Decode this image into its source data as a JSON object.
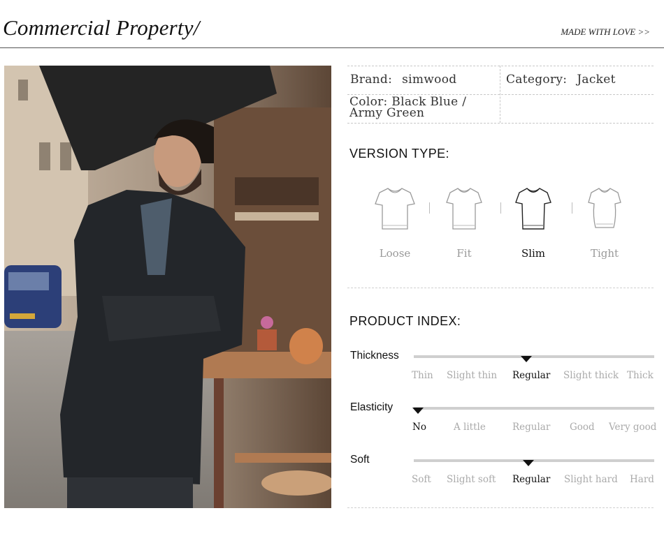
{
  "header": {
    "title": "Commercial Property/",
    "tagline": "MADE WITH LOVE >>"
  },
  "photo": {
    "alt_subject": "model-wearing-black-jacket"
  },
  "specs": {
    "brand_key": "Brand:",
    "brand_value": "simwood",
    "category_key": "Category:",
    "category_value": "Jacket",
    "color_key": "Color:",
    "color_value": "Black Blue / Army Green"
  },
  "version_type": {
    "title": "VERSION TYPE:",
    "items": [
      {
        "label": "Loose",
        "active": false
      },
      {
        "label": "Fit",
        "active": false
      },
      {
        "label": "Slim",
        "active": true
      },
      {
        "label": "Tight",
        "active": false
      }
    ]
  },
  "product_index": {
    "title": "PRODUCT INDEX:",
    "rows": [
      {
        "label": "Thickness",
        "options": [
          "Thin",
          "Slight thin",
          "Regular",
          "Slight thick",
          "Thick"
        ],
        "selected": 2
      },
      {
        "label": "Elasticity",
        "options": [
          "No",
          "A little",
          "Regular",
          "Good",
          "Very good"
        ],
        "selected": 0
      },
      {
        "label": "Soft",
        "options": [
          "Soft",
          "Slight soft",
          "Regular",
          "Slight hard",
          "Hard"
        ],
        "selected": 2
      }
    ]
  },
  "colors": {
    "accent": "#111111",
    "track": "#cfcfcf",
    "muted": "#aaaaaa"
  }
}
